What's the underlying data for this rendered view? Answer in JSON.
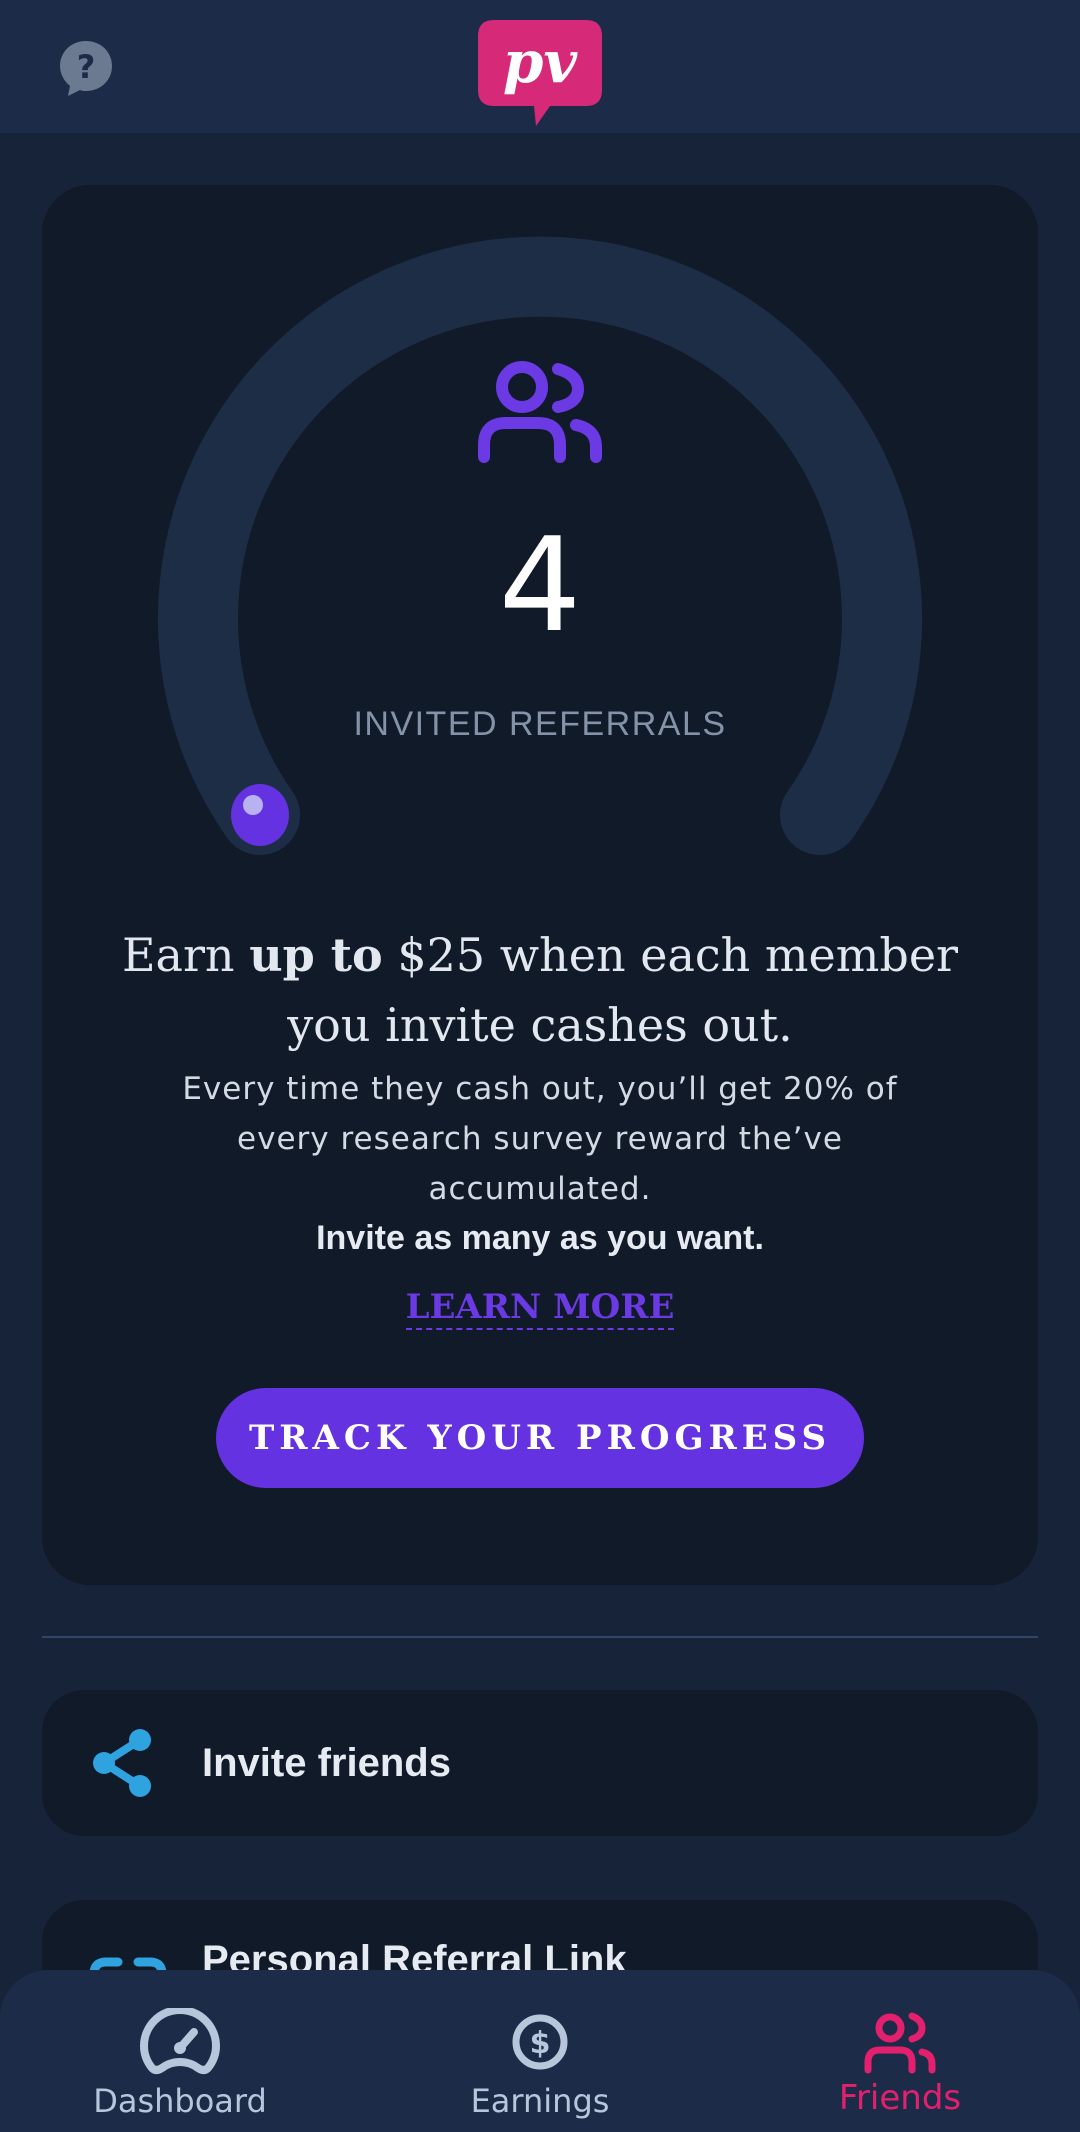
{
  "app": {
    "logo_text": "pv",
    "colors": {
      "brand_pink": "#d62a78",
      "accent_purple": "#6432e0",
      "share_blue": "#2ea3e0"
    }
  },
  "header": {
    "help_icon": "help-circle-icon",
    "logo_icon": "pv-logo-icon"
  },
  "referrals": {
    "count": "4",
    "label": "INVITED REFERRALS",
    "progress_fraction": 0.0
  },
  "promo": {
    "headline_pre": "Earn ",
    "headline_bold": "up to",
    "headline_post": " $25 when each member you invite cashes out.",
    "description": "Every time they cash out, you’ll get 20% of every research survey reward the’ve accumulated.",
    "description_bold": "Invite as many as you want.",
    "learn_more": "LEARN MORE",
    "track_button": "TRACK YOUR PROGRESS"
  },
  "actions": [
    {
      "label": "Invite friends",
      "icon": "share-icon"
    },
    {
      "label": "Personal Referral Link",
      "icon": "link-icon"
    }
  ],
  "bottom_nav": [
    {
      "label": "Dashboard",
      "icon": "dashboard-icon",
      "active": false
    },
    {
      "label": "Earnings",
      "icon": "dollar-icon",
      "active": false
    },
    {
      "label": "Friends",
      "icon": "friends-icon",
      "active": true
    }
  ]
}
